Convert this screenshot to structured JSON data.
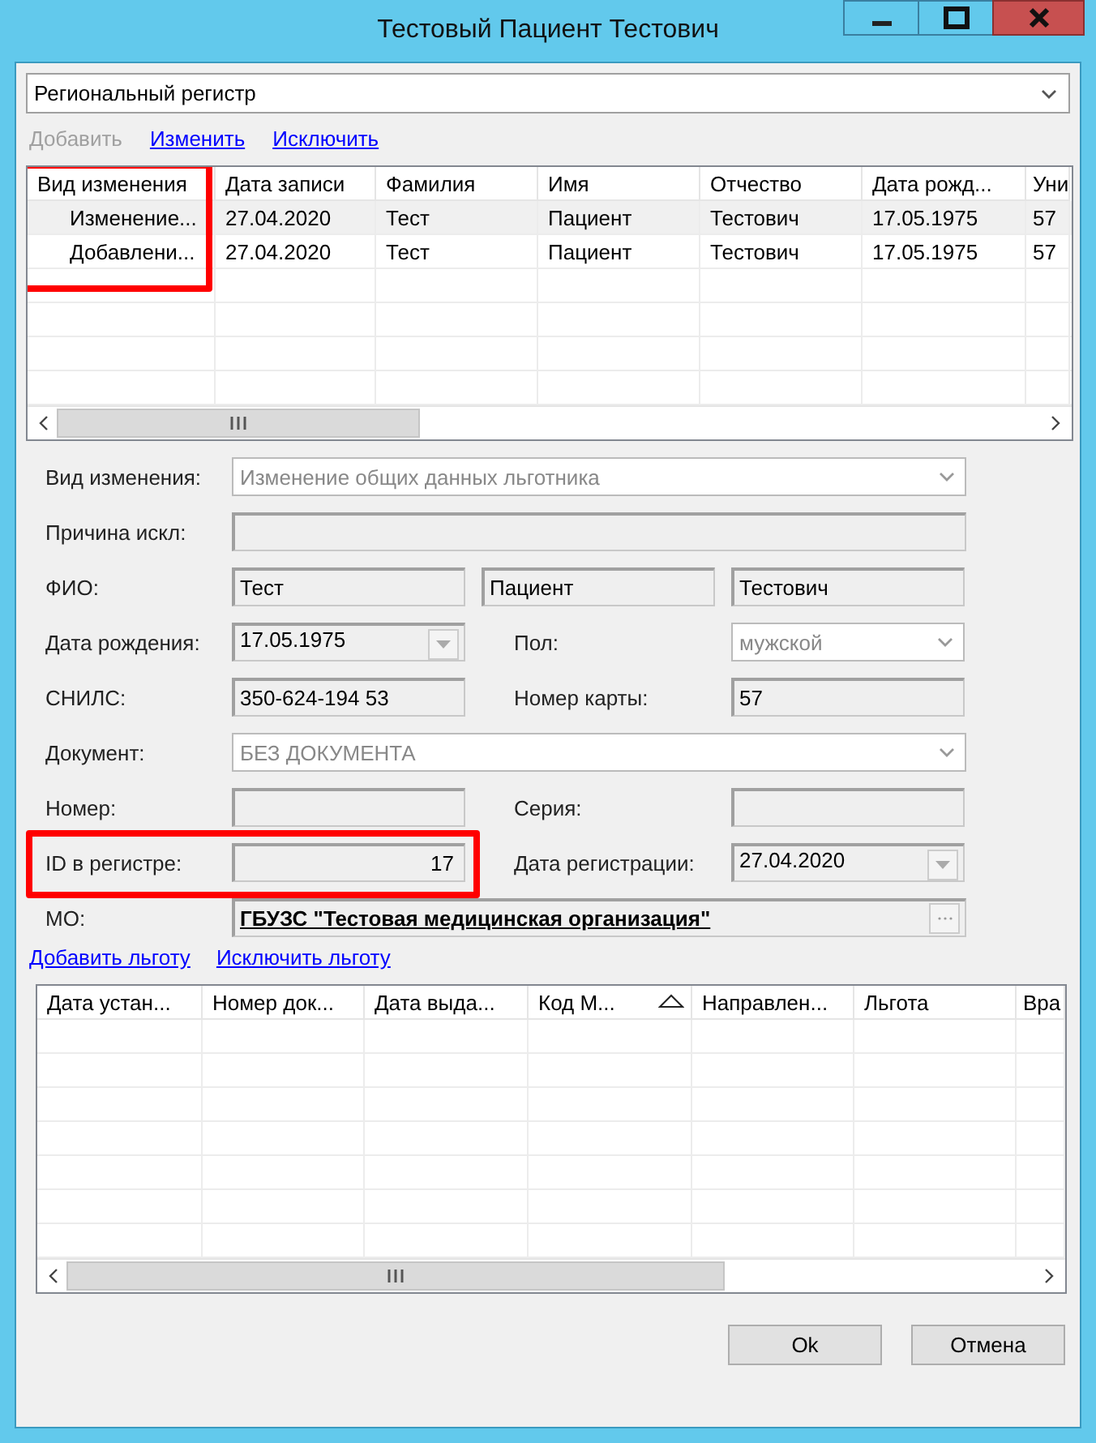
{
  "window": {
    "title": "Тестовый Пациент Тестович"
  },
  "registry": {
    "value": "Региональный регистр"
  },
  "actions": [
    {
      "label": "Добавить",
      "disabled": true
    },
    {
      "label": "Изменить",
      "disabled": false
    },
    {
      "label": "Исключить",
      "disabled": false
    }
  ],
  "changes_table": {
    "columns": [
      {
        "label": "Вид изменения",
        "highlighted": true
      },
      {
        "label": "Дата записи",
        "highlighted": false
      },
      {
        "label": "Фамилия",
        "highlighted": false
      },
      {
        "label": "Имя",
        "highlighted": false
      },
      {
        "label": "Отчество",
        "highlighted": false
      },
      {
        "label": "Дата рожд...",
        "highlighted": false
      },
      {
        "label": "Уни",
        "highlighted": false
      }
    ],
    "rows": [
      {
        "selected": true,
        "cells": [
          "Изменение...",
          "27.04.2020",
          "Тест",
          "Пациент",
          "Тестович",
          "17.05.1975",
          "57"
        ]
      },
      {
        "selected": false,
        "cells": [
          "Добавлени...",
          "27.04.2020",
          "Тест",
          "Пациент",
          "Тестович",
          "17.05.1975",
          "57"
        ]
      }
    ]
  },
  "form": [
    {
      "label": "Вид изменения:",
      "fields": [
        {
          "kind": "combo",
          "value": "Изменение общих данных льготника",
          "disabled": true
        }
      ]
    },
    {
      "label": "Причина искл:",
      "fields": [
        {
          "kind": "text"
        }
      ]
    },
    {
      "label": "ФИО:",
      "fields": [
        {
          "kind": "text",
          "value": "Тест"
        },
        {
          "kind": "text",
          "value": "Пациент"
        },
        {
          "kind": "text",
          "value": "Тестович"
        }
      ]
    },
    {
      "label": "Дата рождения:",
      "fields": [
        {
          "kind": "date",
          "value": "17.05.1975"
        }
      ],
      "label2": "Пол:",
      "fields2": [
        {
          "kind": "combo",
          "value": "мужской",
          "disabled": true
        }
      ]
    },
    {
      "label": "СНИЛС:",
      "fields": [
        {
          "kind": "text",
          "value": "350-624-194 53"
        }
      ],
      "label2": "Номер карты:",
      "fields2": [
        {
          "kind": "text",
          "value": "57"
        }
      ]
    },
    {
      "label": "Документ:",
      "fields": [
        {
          "kind": "combo",
          "value": "БЕЗ ДОКУМЕНТА",
          "disabled": true
        }
      ]
    },
    {
      "label": "Номер:",
      "fields": [
        {
          "kind": "text"
        }
      ],
      "label2": "Серия:",
      "fields2": [
        {
          "kind": "text"
        }
      ]
    },
    {
      "label": "ID в регистре:",
      "highlighted": true,
      "fields": [
        {
          "kind": "number",
          "value": "17"
        }
      ],
      "label2": "Дата регистрации:",
      "fields2": [
        {
          "kind": "date",
          "value": "27.04.2020"
        }
      ]
    },
    {
      "label": "МО:",
      "fields": [
        {
          "kind": "lookup",
          "value": "ГБУЗС \"Тестовая медицинская организация\""
        }
      ]
    }
  ],
  "benefit_actions": [
    {
      "label": "Добавить льготу",
      "disabled": false
    },
    {
      "label": "Исключить льготу",
      "disabled": false
    }
  ],
  "benefits_table": {
    "columns": [
      {
        "label": "Дата устан...",
        "sorted": false
      },
      {
        "label": "Номер док...",
        "sorted": false
      },
      {
        "label": "Дата выда...",
        "sorted": false
      },
      {
        "label": "Код М...",
        "sorted": true
      },
      {
        "label": "Направлен...",
        "sorted": false
      },
      {
        "label": "Льгота",
        "sorted": false
      },
      {
        "label": "Вра",
        "sorted": false
      }
    ]
  },
  "buttons": [
    {
      "label": "Ok"
    },
    {
      "label": "Отмена"
    }
  ]
}
